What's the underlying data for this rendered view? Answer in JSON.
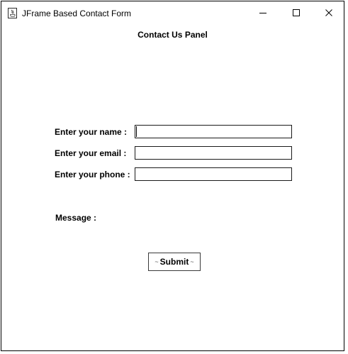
{
  "window": {
    "title": "JFrame Based Contact Form",
    "icons": {
      "app": "java-app-icon",
      "minimize": "minimize-icon",
      "maximize": "maximize-icon",
      "close": "close-icon"
    }
  },
  "panel": {
    "heading": "Contact Us Panel",
    "fields": {
      "name": {
        "label": "Enter your name :",
        "value": ""
      },
      "email": {
        "label": "Enter your email :",
        "value": ""
      },
      "phone": {
        "label": "Enter your phone :",
        "value": ""
      }
    },
    "message_label": "Message :",
    "submit_label": "Submit"
  }
}
